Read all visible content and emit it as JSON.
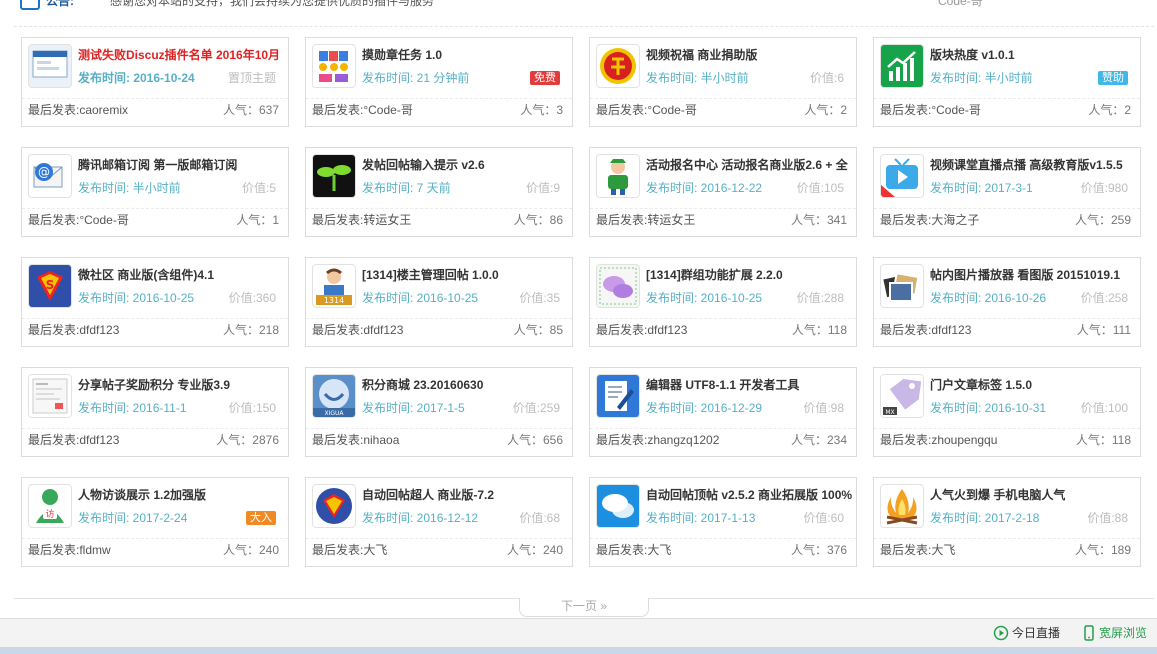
{
  "header": {
    "label": "公告:",
    "notice": "感谢您对本站的支持，我们会持续为您提供优质的插件与服务",
    "right_text": "Code-哥"
  },
  "cards": [
    {
      "title": "测试失败Discuz插件名单 2016年10月",
      "title_red": true,
      "date": "发布时间: 2016-10-24",
      "date_bold": true,
      "side": "置顶主题",
      "tag": "",
      "tag_color": "",
      "poster": "最后发表:caoremix",
      "pop": "人气：637",
      "icon": "website-screenshot-icon"
    },
    {
      "title": "摸勋章任务 1.0",
      "date": "发布时间: 21 分钟前",
      "side": "",
      "tag": "免费",
      "tag_color": "#e23b3b",
      "poster": "最后发表:°Code-哥",
      "pop": "人气：3",
      "icon": "medal-icon"
    },
    {
      "title": "视频祝福 商业捐助版",
      "date": "发布时间: 半小时前",
      "side": "价值:6",
      "tag": "",
      "tag_color": "",
      "poster": "最后发表:°Code-哥",
      "pop": "人气：2",
      "icon": "blessing-seal-icon"
    },
    {
      "title": "版块热度 v1.0.1",
      "date": "发布时间: 半小时前",
      "side": "",
      "tag": "赞助",
      "tag_color": "#3fb8e6",
      "poster": "最后发表:°Code-哥",
      "pop": "人气：2",
      "icon": "trend-chart-icon"
    },
    {
      "title": "腾讯邮箱订阅 第一版邮箱订阅",
      "date": "发布时间: 半小时前",
      "side": "价值:5",
      "tag": "",
      "tag_color": "",
      "poster": "最后发表:°Code-哥",
      "pop": "人气：1",
      "icon": "mail-at-icon"
    },
    {
      "title": "发帖回帖输入提示 v2.6",
      "date": "发布时间: 7 天前",
      "side": "价值:9",
      "tag": "",
      "tag_color": "",
      "poster": "最后发表:转运女王",
      "pop": "人气：86",
      "icon": "sprout-icon"
    },
    {
      "title": "活动报名中心 活动报名商业版2.6 + 全",
      "date": "发布时间: 2016-12-22",
      "side": "价值:105",
      "tag": "",
      "tag_color": "",
      "poster": "最后发表:转运女王",
      "pop": "人气：341",
      "icon": "hiker-icon"
    },
    {
      "title": "视频课堂直播点播 高级教育版v1.5.5",
      "date": "发布时间: 2017-3-1",
      "side": "价值:980",
      "tag": "",
      "tag_color": "",
      "poster": "最后发表:大海之子",
      "pop": "人气：259",
      "icon": "tv-play-icon"
    },
    {
      "title": "微社区 商业版(含组件)4.1",
      "date": "发布时间: 2016-10-25",
      "side": "价值:360",
      "tag": "",
      "tag_color": "",
      "poster": "最后发表:dfdf123",
      "pop": "人气：218",
      "icon": "superman-shield-icon"
    },
    {
      "title": "[1314]楼主管理回帖 1.0.0",
      "date": "发布时间: 2016-10-25",
      "side": "价值:35",
      "tag": "",
      "tag_color": "",
      "poster": "最后发表:dfdf123",
      "pop": "人气：85",
      "icon": "user-1314-icon"
    },
    {
      "title": "[1314]群组功能扩展 2.2.0",
      "date": "发布时间: 2016-10-25",
      "side": "价值:288",
      "tag": "",
      "tag_color": "",
      "poster": "最后发表:dfdf123",
      "pop": "人气：118",
      "icon": "chat-group-icon"
    },
    {
      "title": "帖内图片播放器 看图版 20151019.1",
      "date": "发布时间: 2016-10-26",
      "side": "价值:258",
      "tag": "",
      "tag_color": "",
      "poster": "最后发表:dfdf123",
      "pop": "人气：111",
      "icon": "photos-icon"
    },
    {
      "title": "分享帖子奖励积分 专业版3.9",
      "date": "发布时间: 2016-11-1",
      "side": "价值:150",
      "tag": "",
      "tag_color": "",
      "poster": "最后发表:dfdf123",
      "pop": "人气：2876",
      "icon": "page-screenshot-icon"
    },
    {
      "title": "积分商城 23.20160630",
      "date": "发布时间: 2017-1-5",
      "side": "价值:259",
      "tag": "",
      "tag_color": "",
      "poster": "最后发表:nihaoa",
      "pop": "人气：656",
      "icon": "xigua-smile-icon"
    },
    {
      "title": "编辑器 UTF8-1.1 开发者工具",
      "date": "发布时间: 2016-12-29",
      "side": "价值:98",
      "tag": "",
      "tag_color": "",
      "poster": "最后发表:zhangzq1202",
      "pop": "人气：234",
      "icon": "edit-document-icon"
    },
    {
      "title": "门户文章标签 1.5.0",
      "date": "发布时间: 2016-10-31",
      "side": "价值:100",
      "tag": "",
      "tag_color": "",
      "poster": "最后发表:zhoupengqu",
      "pop": "人气：118",
      "icon": "price-tag-icon"
    },
    {
      "title": "人物访谈展示 1.2加强版",
      "date": "发布时间: 2017-2-24",
      "side": "",
      "tag": "大入",
      "tag_color": "#f08a24",
      "poster": "最后发表:fldmw",
      "pop": "人气：240",
      "icon": "interview-user-icon"
    },
    {
      "title": "自动回帖超人 商业版-7.2",
      "date": "发布时间: 2016-12-12",
      "side": "价值:68",
      "tag": "",
      "tag_color": "",
      "poster": "最后发表:大飞",
      "pop": "人气：240",
      "icon": "superman-logo-icon"
    },
    {
      "title": "自动回帖顶帖 v2.5.2 商业拓展版 100%",
      "date": "发布时间: 2017-1-13",
      "side": "价值:60",
      "tag": "",
      "tag_color": "",
      "poster": "最后发表:大飞",
      "pop": "人气：376",
      "icon": "speech-bubbles-icon"
    },
    {
      "title": "人气火到爆 手机电脑人气",
      "date": "发布时间: 2017-2-18",
      "side": "价值:88",
      "tag": "",
      "tag_color": "",
      "poster": "最后发表:大飞",
      "pop": "人气：189",
      "icon": "bonfire-icon"
    }
  ],
  "pager": {
    "next_label": "下一页 »"
  },
  "footer": {
    "live_label": "今日直播",
    "wide_label": "宽屏浏览"
  },
  "colors": {
    "date": "#57b0c6",
    "title_red": "#e02222",
    "footer_green": "#22a04a"
  }
}
